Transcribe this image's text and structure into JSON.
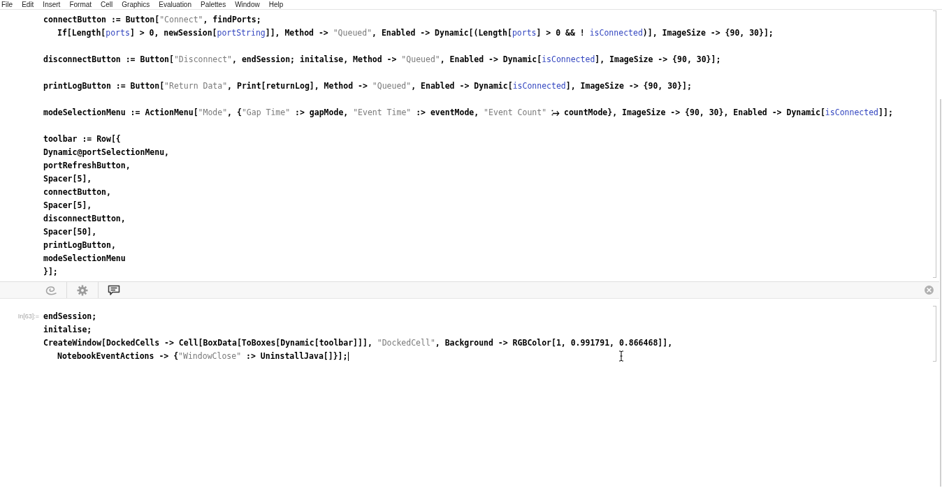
{
  "menu_bar": [
    "File",
    "Edit",
    "Insert",
    "Format",
    "Cell",
    "Graphics",
    "Evaluation",
    "Palettes",
    "Window",
    "Help"
  ],
  "cell_1": {
    "statements": [
      {
        "lines": [
          {
            "segments": [
              {
                "kind": "code",
                "text": "connectButton := Button["
              },
              {
                "kind": "string",
                "text": "\"Connect\""
              },
              {
                "kind": "code",
                "text": ", findPorts;"
              }
            ],
            "children": [
              {
                "segments": [
                  {
                    "kind": "code",
                    "text": "If[Length["
                  },
                  {
                    "kind": "symbol",
                    "text": "ports"
                  },
                  {
                    "kind": "code",
                    "text": "] > 0, newSession["
                  },
                  {
                    "kind": "symbol",
                    "text": "portString"
                  },
                  {
                    "kind": "code",
                    "text": "]], Method -> "
                  },
                  {
                    "kind": "string",
                    "text": "\"Queued\""
                  },
                  {
                    "kind": "code",
                    "text": ", Enabled -> Dynamic[(Length["
                  },
                  {
                    "kind": "symbol",
                    "text": "ports"
                  },
                  {
                    "kind": "code",
                    "text": "] > 0 && ! "
                  },
                  {
                    "kind": "symbol",
                    "text": "isConnected"
                  },
                  {
                    "kind": "code",
                    "text": ")], ImageSize -> {90, 30}];"
                  }
                ]
              }
            ]
          }
        ]
      },
      {
        "lines": [
          {
            "segments": [
              {
                "kind": "code",
                "text": "disconnectButton := Button["
              },
              {
                "kind": "string",
                "text": "\"Disconnect\""
              },
              {
                "kind": "code",
                "text": ", endSession; initalise, Method -> "
              },
              {
                "kind": "string",
                "text": "\"Queued\""
              },
              {
                "kind": "code",
                "text": ", Enabled -> Dynamic["
              },
              {
                "kind": "symbol",
                "text": "isConnected"
              },
              {
                "kind": "code",
                "text": "], ImageSize -> {90, 30}];"
              }
            ]
          }
        ]
      },
      {
        "lines": [
          {
            "segments": [
              {
                "kind": "code",
                "text": "printLogButton := Button["
              },
              {
                "kind": "string",
                "text": "\"Return Data\""
              },
              {
                "kind": "code",
                "text": ", Print[returnLog], Method -> "
              },
              {
                "kind": "string",
                "text": "\"Queued\""
              },
              {
                "kind": "code",
                "text": ", Enabled -> Dynamic["
              },
              {
                "kind": "symbol",
                "text": "isConnected"
              },
              {
                "kind": "code",
                "text": "], ImageSize -> {90, 30}];"
              }
            ]
          }
        ]
      },
      {
        "lines": [
          {
            "segments": [
              {
                "kind": "code",
                "text": "modeSelectionMenu := ActionMenu["
              },
              {
                "kind": "string",
                "text": "\"Mode\""
              },
              {
                "kind": "code",
                "text": ", {"
              },
              {
                "kind": "string",
                "text": "\"Gap Time\""
              },
              {
                "kind": "code",
                "text": " :> gapMode, "
              },
              {
                "kind": "string",
                "text": "\"Event Time\""
              },
              {
                "kind": "code",
                "text": " :> eventMode, "
              },
              {
                "kind": "string",
                "text": "\"Event Count\""
              },
              {
                "kind": "code",
                "text": " ⧴ countMode}, ImageSize -> {90, 30}, Enabled -> Dynamic["
              },
              {
                "kind": "symbol",
                "text": "isConnected"
              },
              {
                "kind": "code",
                "text": "]];"
              }
            ]
          }
        ]
      },
      {
        "lines": [
          {
            "segments": [
              {
                "kind": "code",
                "text": "toolbar := Row[{"
              }
            ]
          },
          {
            "segments": [
              {
                "kind": "code",
                "text": "Dynamic@portSelectionMenu,"
              }
            ]
          },
          {
            "segments": [
              {
                "kind": "code",
                "text": "portRefreshButton,"
              }
            ]
          },
          {
            "segments": [
              {
                "kind": "code",
                "text": "Spacer[5],"
              }
            ]
          },
          {
            "segments": [
              {
                "kind": "code",
                "text": "connectButton,"
              }
            ]
          },
          {
            "segments": [
              {
                "kind": "code",
                "text": "Spacer[5],"
              }
            ]
          },
          {
            "segments": [
              {
                "kind": "code",
                "text": "disconnectButton,"
              }
            ]
          },
          {
            "segments": [
              {
                "kind": "code",
                "text": "Spacer[50],"
              }
            ]
          },
          {
            "segments": [
              {
                "kind": "code",
                "text": "printLogButton,"
              }
            ]
          },
          {
            "segments": [
              {
                "kind": "code",
                "text": "modeSelectionMenu"
              }
            ]
          },
          {
            "segments": [
              {
                "kind": "code",
                "text": "}];"
              }
            ]
          }
        ]
      }
    ]
  },
  "cell_2": {
    "label": "In[63]:=",
    "caret": true,
    "lines": [
      {
        "segments": [
          {
            "kind": "code",
            "text": "endSession;"
          }
        ]
      },
      {
        "segments": [
          {
            "kind": "code",
            "text": "initalise;"
          }
        ]
      },
      {
        "segments": [
          {
            "kind": "code",
            "text": "CreateWindow[DockedCells -> Cell[BoxData[ToBoxes[Dynamic[toolbar]]], "
          },
          {
            "kind": "string",
            "text": "\"DockedCell\""
          },
          {
            "kind": "code",
            "text": ", Background -> RGBColor[1, 0.991791, 0.866468]],"
          }
        ],
        "children": [
          {
            "segments": [
              {
                "kind": "code",
                "text": "NotebookEventActions -> {"
              },
              {
                "kind": "string",
                "text": "\"WindowClose\""
              },
              {
                "kind": "code",
                "text": " :> UninstallJava[]}];"
              }
            ]
          }
        ]
      }
    ]
  }
}
